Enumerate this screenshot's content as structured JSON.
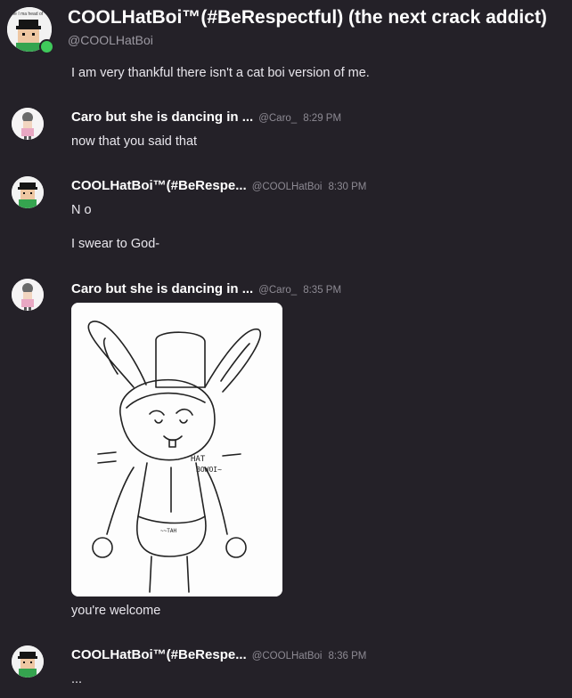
{
  "profile": {
    "display_name": "COOLHatBoi™(#BeRespectful) (the next crack addict)",
    "handle": "@COOLHatBoi",
    "avatar_caption": "me I ma head of",
    "status_color": "#3fc95b"
  },
  "messages": [
    {
      "text": "I am very thankful there isn't a cat boi version of me."
    },
    {
      "author": "Caro but she is dancing in ...",
      "handle": "@Caro_",
      "time": "8:29 PM",
      "lines": [
        "now that you said that"
      ]
    },
    {
      "author": "COOLHatBoi™(#BeRespe...",
      "handle": "@COOLHatBoi",
      "time": "8:30 PM",
      "lines": [
        "N o",
        "I swear to God-"
      ]
    },
    {
      "author": "Caro but she is dancing in ...",
      "handle": "@Caro_",
      "time": "8:35 PM",
      "attachment": {
        "caption_1": "HAT",
        "caption_2": "BOWOI~",
        "apron_text": "~~TAH"
      },
      "lines": [
        "you're welcome"
      ]
    },
    {
      "author": "COOLHatBoi™(#BeRespe...",
      "handle": "@COOLHatBoi",
      "time": "8:36 PM",
      "lines": [
        "..."
      ]
    }
  ]
}
